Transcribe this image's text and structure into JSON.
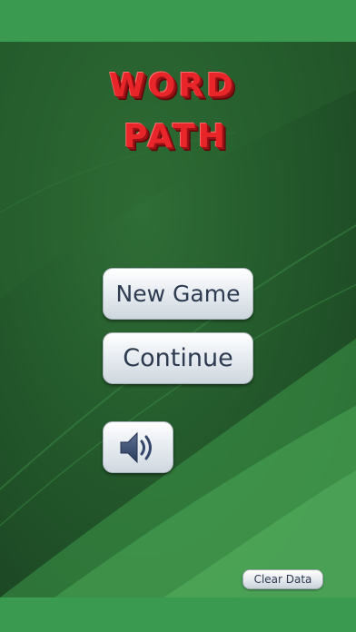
{
  "title": {
    "line1": "WORD",
    "line2": "PATH",
    "color": "#e8262a"
  },
  "menu": {
    "new_game_label": "New Game",
    "continue_label": "Continue",
    "sound_icon": "speaker-volume-icon",
    "clear_data_label": "Clear Data"
  },
  "colors": {
    "frame_green": "#3a9a4f",
    "background_green": "#245a2c",
    "button_text": "#2d3a50"
  }
}
